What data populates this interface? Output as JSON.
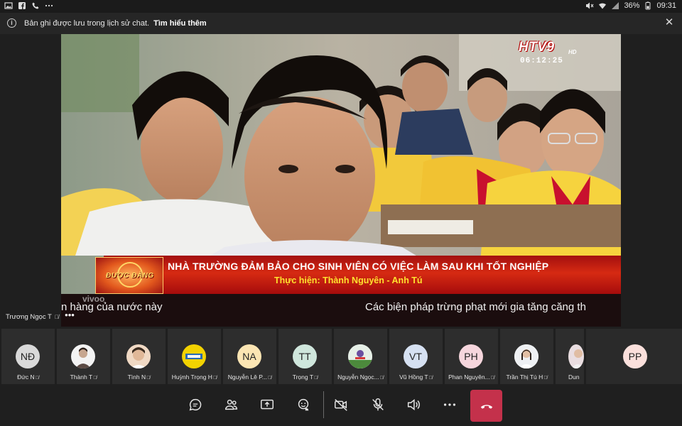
{
  "status_bar": {
    "battery": "36%",
    "time": "09:31",
    "left_icons": [
      "image-icon",
      "facebook-icon",
      "phone-icon",
      "more-icon"
    ],
    "right_icons": [
      "mute-icon",
      "wifi-icon",
      "signal-icon",
      "battery-icon"
    ]
  },
  "banner": {
    "text": "Bản ghi được lưu trong lịch sử chat.",
    "link": "Tìm hiểu thêm"
  },
  "video": {
    "channel_logo": "HTV9",
    "channel_hd": "HD",
    "channel_clock": "06:12:25",
    "badge_text": "ĐƯỢC ĐÀNG",
    "headline": "NHÀ TRƯỜNG ĐẢM BẢO CHO SINH VIÊN CÓ VIỆC LÀM SAU KHI TỐT NGHIỆP",
    "credit": "Thực hiện: Thành Nguyên - Anh Tú",
    "ticker_left": "n hàng của nước này",
    "ticker_right": "Các biện pháp trừng phạt mới gia tăng căng th",
    "watermark": "vivoo"
  },
  "speaker": {
    "name": "Trương Ngọc T"
  },
  "participants": [
    {
      "name": "Đức N",
      "initials": "NĐ",
      "color": "#d9d9d9"
    },
    {
      "name": "Thành T",
      "initials": "",
      "color": "#f3f3f3"
    },
    {
      "name": "Tình N",
      "initials": "",
      "color": "#f0d9c4"
    },
    {
      "name": "Huỳnh Trọng H",
      "initials": "",
      "color": "#f2d200"
    },
    {
      "name": "Nguyễn Lê P...",
      "initials": "NA",
      "color": "#fbe5b3"
    },
    {
      "name": "Trọng T",
      "initials": "TT",
      "color": "#cfe6dc"
    },
    {
      "name": "Nguyễn Ngọc...",
      "initials": "",
      "color": "#e6efe7"
    },
    {
      "name": "Vũ Hồng T",
      "initials": "VT",
      "color": "#d6e1f2"
    },
    {
      "name": "Phan Nguyên...",
      "initials": "PH",
      "color": "#f6d6dd"
    },
    {
      "name": "Trần Thị Tú H",
      "initials": "",
      "color": "#f4f4f4"
    },
    {
      "name": "Dun",
      "initials": "",
      "color": "#e9dde0"
    },
    {
      "name": "",
      "initials": "PP",
      "color": "#fbe0dc"
    }
  ],
  "controls": [
    "chat-icon",
    "people-icon",
    "share-screen-icon",
    "raise-hand-icon",
    "camera-off-icon",
    "mic-off-icon",
    "speaker-icon",
    "more-icon",
    "hang-up-icon"
  ],
  "colors": {
    "hangup": "#c4314b",
    "headline_text": "#ffffff",
    "credit_text": "#ffe22e"
  }
}
